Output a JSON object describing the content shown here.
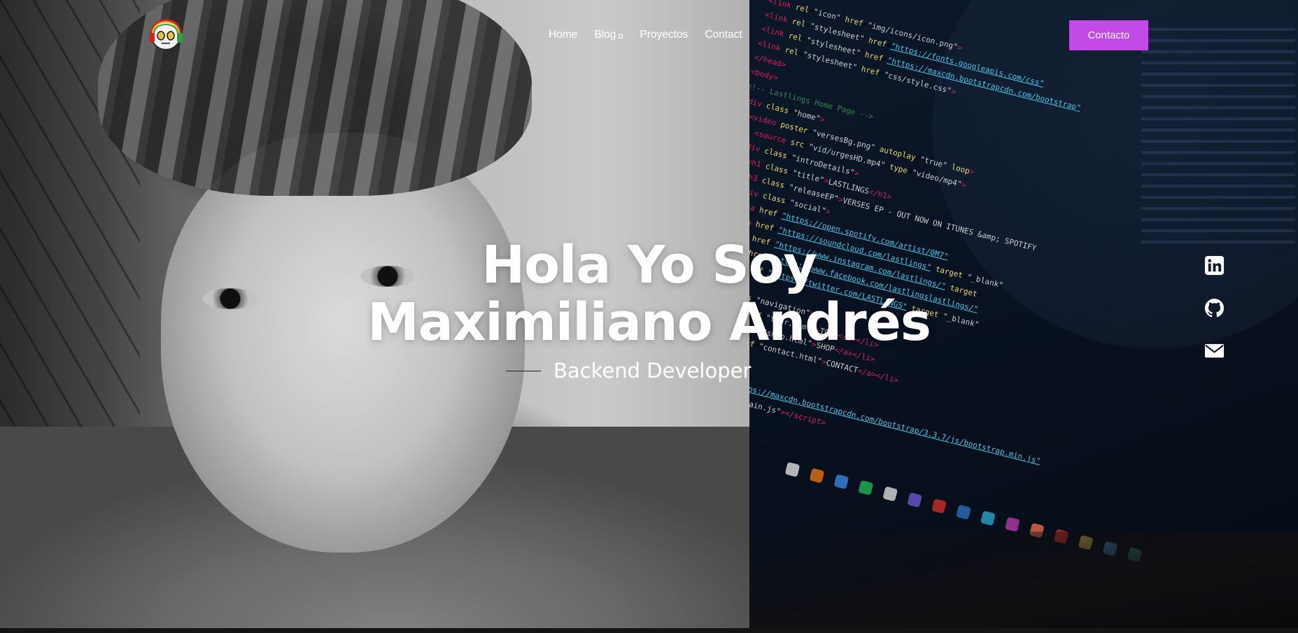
{
  "brand": {
    "logo_icon": "skull-with-headphones-logo"
  },
  "nav": {
    "items": [
      {
        "label": "Home",
        "icon": null
      },
      {
        "label": "Blog",
        "icon": "dropdown-caret-icon"
      },
      {
        "label": "Proyectos",
        "icon": null
      },
      {
        "label": "Contact",
        "icon": null
      }
    ],
    "cta_label": "Contacto",
    "cta_color": "#c34ae6"
  },
  "hero": {
    "title_line1": "Hola Yo Soy",
    "title_line2": "Maximiliano Andrés",
    "role": "Backend Developer"
  },
  "social": [
    {
      "icon": "linkedin-icon"
    },
    {
      "icon": "github-icon"
    },
    {
      "icon": "email-icon"
    }
  ]
}
